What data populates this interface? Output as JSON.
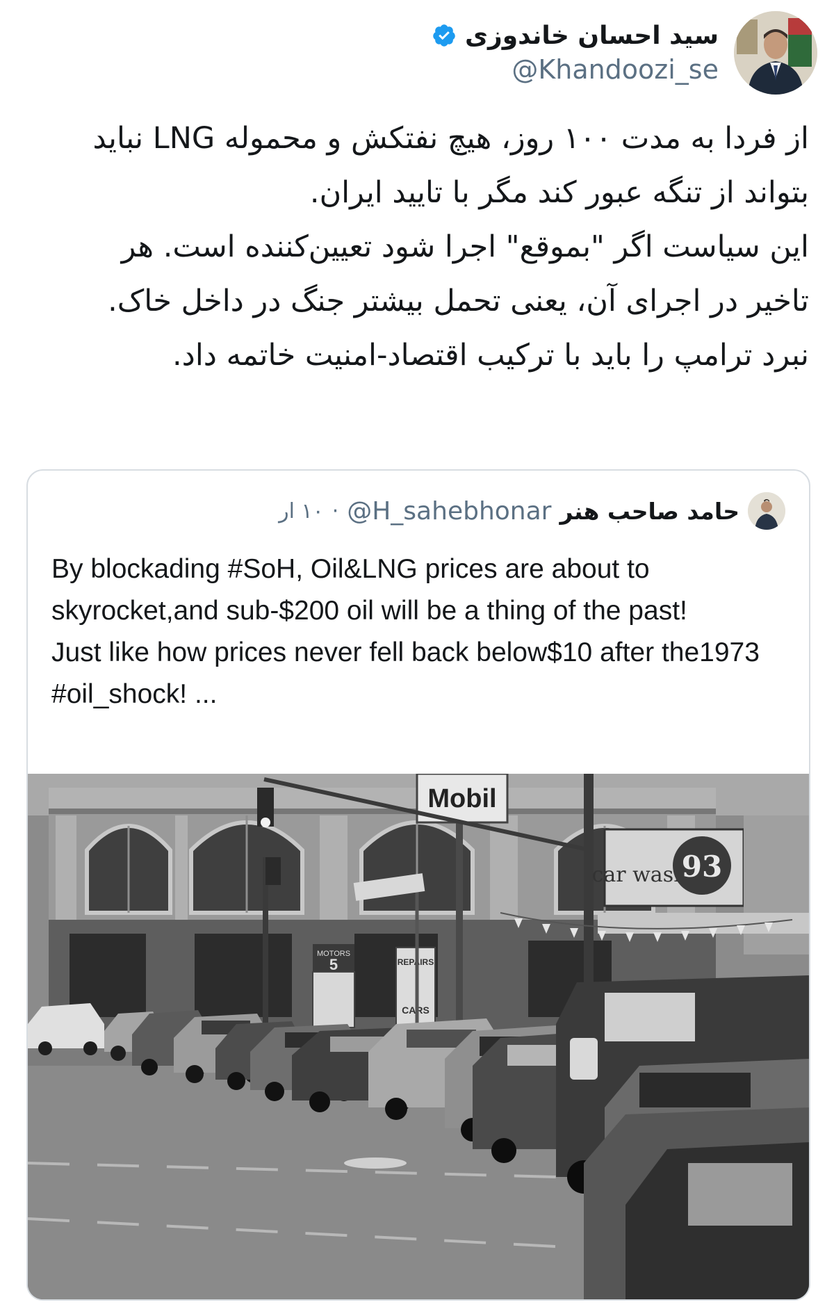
{
  "author": {
    "display_name": "سید احسان خاندوزی",
    "handle": "@Khandoozi_se",
    "verified_icon": "verified-badge-icon"
  },
  "tweet": {
    "paragraphs": [
      "از فردا به مدت ۱۰۰ روز، هیچ نفتکش و محموله LNG نباید بتواند از تنگه عبور کند مگر با تایید ایران.",
      "این سیاست اگر \"بموقع\" اجرا شود تعیین‌کننده است. هر تاخیر در اجرای آن، یعنی تحمل بیشتر جنگ در داخل خاک.",
      "نبرد ترامپ را باید با ترکیب اقتصاد-امنیت خاتمه داد."
    ]
  },
  "quoted_tweet": {
    "display_name": "حامد صاحب هنر",
    "handle": "@H_sahebhonar",
    "separator": "·",
    "time": "۱۰ ار",
    "lines": [
      "By blockading #SoH, Oil&LNG prices are about to skyrocket,and sub-$200 oil will be a thing of the past!",
      "Just like how prices never fell back below$10 after the1973 #oil_shock!  ..."
    ],
    "photo": {
      "alt": "1973 gas station queue photo",
      "signs": {
        "mobil": "Mobil",
        "car_wash": "car wash",
        "number": "93",
        "motors": "MOTORS",
        "price": "5",
        "repairs": "REPAIRS",
        "cars": "CARS"
      }
    }
  },
  "colors": {
    "text": "#14171a",
    "secondary": "#5b7083",
    "verified": "#1d9bf0",
    "border": "#d8dde2"
  }
}
